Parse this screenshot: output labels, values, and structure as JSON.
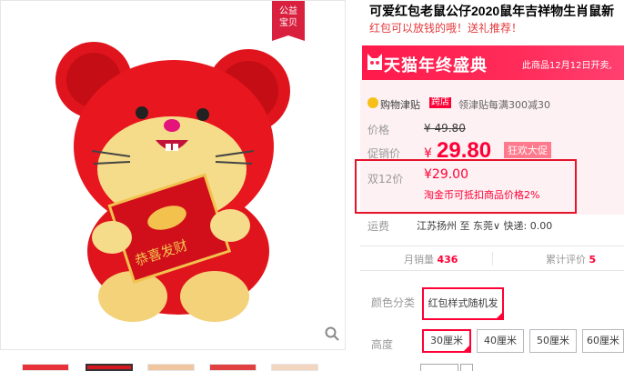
{
  "product": {
    "title": "可爱红包老鼠公仔2020鼠年吉祥物生肖鼠新",
    "subtitle": "红包可以放钱的哦！送礼推荐！"
  },
  "badge": {
    "line1": "公益",
    "line2": "宝贝"
  },
  "banner": {
    "title": "天猫年终盛典",
    "note": "此商品12月12日开卖,"
  },
  "coupon": {
    "name": "购物津贴",
    "tag": "跨店",
    "desc": "领津贴每满300减30"
  },
  "price": {
    "label": "价格",
    "currency": "¥",
    "original": "49.80",
    "sale_label": "促销价",
    "sale": "29.80",
    "sale_tag": "狂欢大促"
  },
  "double12": {
    "label": "双12价",
    "price": "¥29.00",
    "note": "淘金币可抵扣商品价格2%"
  },
  "shipping": {
    "label": "运费",
    "text": "江苏扬州 至 东莞∨ 快递: 0.00"
  },
  "stats": {
    "monthly_label": "月销量",
    "monthly_value": "436",
    "reviews_label": "累计评价",
    "reviews_value": "5"
  },
  "sku": {
    "color_label": "颜色分类",
    "color_option": "红包样式随机发",
    "height_label": "高度",
    "heights": [
      "30厘米",
      "40厘米",
      "50厘米",
      "60厘米"
    ],
    "selected_height_index": 0
  },
  "colors": {
    "tmall_red": "#ff0036",
    "banner_red": "#ff2c5a",
    "highlight_border": "#e4142c",
    "price_bg": "#fdf1f3"
  }
}
